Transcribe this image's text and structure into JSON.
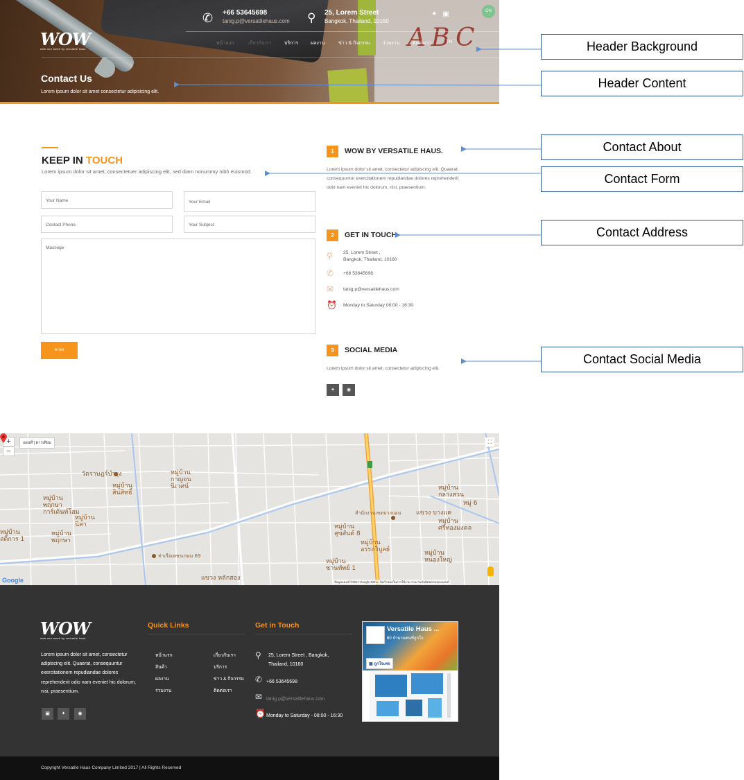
{
  "header": {
    "phone": "+66 53645698",
    "email": "tanig.p@versatilehaus.com",
    "address": "25, Lorem Street",
    "city": "Bangkok, Thailand, 10160",
    "lang_toggle": "ON",
    "logo": "WOW",
    "logo_sub": "web one week by versatile haus",
    "nav": [
      "หน้าแรก",
      "เกี่ยวกับเรา",
      "บริการ",
      "ผลงาน",
      "ข่าว & กิจกรรม",
      "ร่วมงาน",
      "ติดต่อเรา",
      "TH"
    ],
    "title": "Contact Us",
    "subtitle": "Lorem ipsum dolor sit amet consectetur adipisicing elit."
  },
  "annotations": {
    "header_background": "Header Background",
    "header_content": "Header Content",
    "contact_about": "Contact About",
    "contact_form": "Contact Form",
    "contact_address": "Contact Address",
    "contact_social": "Contact Social Media"
  },
  "form": {
    "title_a": "KEEP IN ",
    "title_b": "TOUCH",
    "subtitle": "Lorem ipsum dolor sit amet, consectetuer adipiscing elit, sed diam nonummy nibh euismod.",
    "name_placeholder": "Your Name",
    "email_placeholder": "Your Email",
    "phone_placeholder": "Contact Phone",
    "subject_placeholder": "Your Subject",
    "message_placeholder": "Massege",
    "submit": "ตกลง"
  },
  "about": {
    "num": "1",
    "title": "WOW BY VERSATILE HAUS.",
    "text": "Lorem ipsum dolor sit amet, consectetur adipiscing elit. Quaerat, consequuntur exercitationem repudiandae dolores reprehenderit odio nam eveniet hic dolorum, nisi, praesentium."
  },
  "get_in_touch": {
    "num": "2",
    "title": "GET IN TOUCH",
    "address_line1": "25, Lorem Street ,",
    "address_line2": "Bangkok, Thailand, 10160",
    "phone": "+66 53645698",
    "email": "tanig.p@versatilehaus.com",
    "hours": "Monday to Saturday 08:00 - 16:30"
  },
  "social": {
    "num": "3",
    "title": "SOCIAL MEDIA",
    "text": "Lorem ipsum dolor sit amet, consectetur adipiscing elit.",
    "icons": [
      "twitter-icon",
      "line-icon"
    ]
  },
  "map": {
    "map_type": "แผนที่",
    "satellite": "ดาวเทียม",
    "attribution": "ข้อมูลแผนที่ ©2017 Google   200 ม.        ข้อกำหนดในการใช้งาน   รายงานข้อผิดพลาดของแผนที่",
    "google": "Google",
    "labels": [
      "วัดราษฎร์บำรุง",
      "หมู่บ้าน\nกาญจน\nนิเวศน์",
      "หมู่บ้าน\nสินสิทธิ์",
      "หมู่บ้าน\nพฤกษา\nการ์เด้นท์โฮม",
      "หมู่บ้าน\nพฤกษา",
      "หมู่บ้าน\nสุขสันต์ 8",
      "สำนักงานเขตบางบอน",
      "แขวง บางแค",
      "หมู่บ้าน\nศรีทองมงคล",
      "หมู่บ้าน\nกลางสวน",
      "หมู่ 6",
      "หมู่บ้าน\nอรรถวิบูลย์",
      "หมู่บ้าน\nหนองใหญ่",
      "หมู่บ้าน\nชานทัพย์ 1",
      "แขวง หลักสอง",
      "ท่าเรือเพชรเกษม 69",
      "หมู่บ้าน\nนิสา",
      "หมู่บ้าน\nสติการ 1"
    ]
  },
  "footer": {
    "logo": "WOW",
    "logo_sub": "web one week by versatile haus",
    "about": "Lorem ipsum dolor sit amet, consectetur adipiscing elit. Quaerat, consequuntur exercitationem repudiandae dolores reprehenderit odio nam eveniet hic dolorum, nisi, praesentium.",
    "quick_links_title": "Quick Links",
    "quick_links": [
      "หน้าแรก",
      "เกี่ยวกับเรา",
      "สินค้า",
      "บริการ",
      "ผลงาน",
      "ข่าว & กิจกรรม",
      "ร่วมงาน",
      "ติดต่อเรา"
    ],
    "get_in_touch_title": "Get in Touch",
    "address1": "25, Lorem Street , Bangkok,",
    "address2": "Thailand, 10160",
    "phone": "+66 53645698",
    "email": "tanig.p@versatilehaus.com",
    "hours": "Monday to Saturday - 08:00 - 16:30",
    "fb_name": "Versatile Haus ...",
    "fb_likes": "60 จำนวนคนที่ถูกใจ",
    "fb_like_btn": "ถูกใจเพจ",
    "copyright": "Copyright Versatile Haus Company Limited 2017 | All Rights Reserved"
  },
  "colors": {
    "accent": "#f7941d",
    "footer_bg": "#333333",
    "footer_bottom": "#111111",
    "annotation_border": "#2f5597",
    "map_lang_green": "#7ec28e"
  }
}
